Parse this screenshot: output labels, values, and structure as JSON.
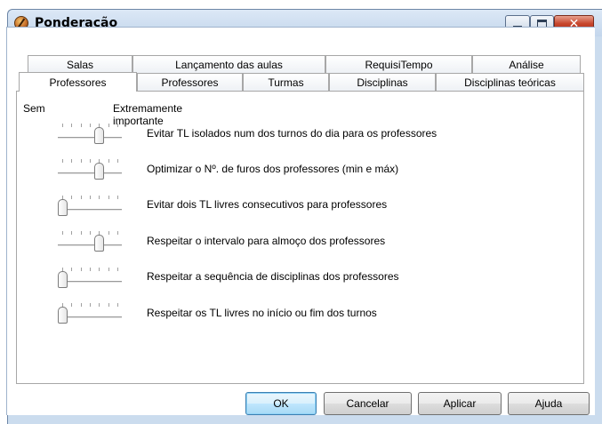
{
  "window": {
    "title": "Ponderação"
  },
  "title_controls": {
    "minimize_icon": "minimize-icon",
    "maximize_icon": "maximize-icon",
    "close_icon": "close-icon",
    "close_glyph": "✕"
  },
  "tabs_back_row": [
    {
      "label": "Salas"
    },
    {
      "label": "Lançamento das aulas"
    },
    {
      "label": "RequisiTempo"
    },
    {
      "label": "Análise"
    }
  ],
  "tabs_front_row": [
    {
      "label": "Professores",
      "active": true
    },
    {
      "label": "Professores",
      "active": false
    },
    {
      "label": "Turmas",
      "active": false
    },
    {
      "label": "Disciplinas",
      "active": false
    },
    {
      "label": "Disciplinas teóricas",
      "active": false
    }
  ],
  "scale": {
    "left_label": "Sem",
    "right_label": "Extremamente importante"
  },
  "criteria": [
    {
      "label": "Evitar TL isolados num dos turnos do dia para os professores",
      "level": 0.67
    },
    {
      "label": "Optimizar o Nº. de furos dos professores (min e máx)",
      "level": 0.67
    },
    {
      "label": "Evitar dois TL livres consecutivos para professores",
      "level": 0.0
    },
    {
      "label": "Respeitar o intervalo para almoço dos professores",
      "level": 0.67
    },
    {
      "label": "Respeitar a sequência de disciplinas dos professores",
      "level": 0.0
    },
    {
      "label": "Respeitar os TL livres no início ou fim dos turnos",
      "level": 0.0
    }
  ],
  "buttons": {
    "ok": "OK",
    "cancel": "Cancelar",
    "apply": "Aplicar",
    "help": "Ajuda"
  },
  "colors": {
    "titlebar": "#c3d6ec",
    "close_button": "#c7462d",
    "default_button": "#bee6fd"
  }
}
